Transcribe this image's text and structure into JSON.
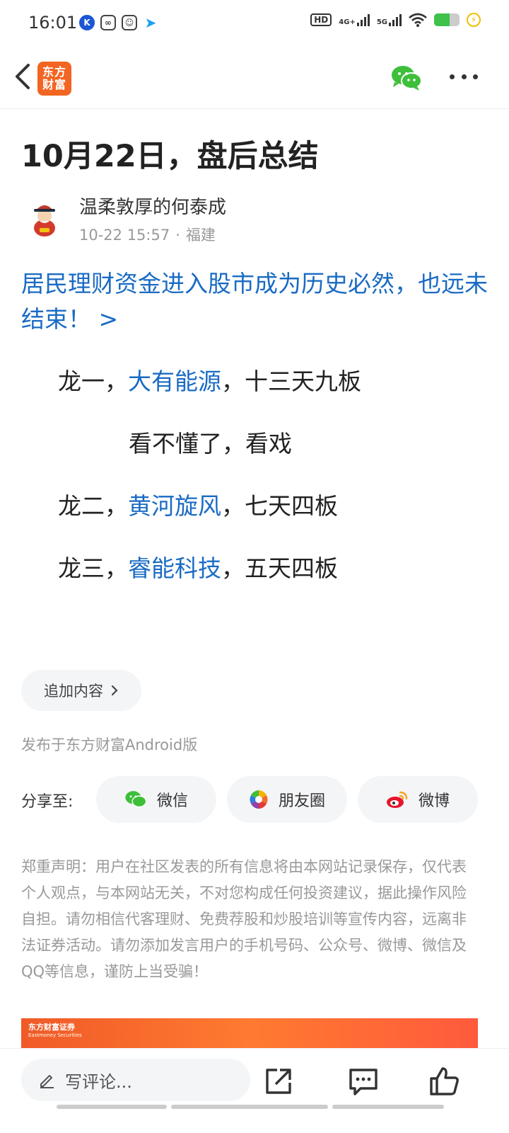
{
  "status_bar": {
    "time": "16:01",
    "network_hd": "HD",
    "network_4g": "4G+",
    "network_5g": "5G",
    "battery_level": 0.6
  },
  "header": {
    "logo_line1": "东方",
    "logo_line2": "财富",
    "icons": [
      "back-arrow-icon",
      "wechat-icon",
      "more-icon"
    ]
  },
  "article": {
    "title": "10月22日，盘后总结",
    "author": "温柔敦厚的何泰成",
    "time": "10-22 15:57",
    "location": "福建",
    "link_text": "居民理财资金进入股市成为历史必然，也远未结束！ >",
    "lines": [
      {
        "prefix": "龙一，",
        "stock": "大有能源",
        "suffix": "，十三天九板"
      },
      {
        "text": "看不懂了，看戏"
      },
      {
        "prefix": "龙二，",
        "stock": "黄河旋风",
        "suffix": "，七天四板"
      },
      {
        "prefix": "龙三，",
        "stock": "睿能科技",
        "suffix": "，五天四板"
      }
    ]
  },
  "append_label": "追加内容",
  "published": "发布于东方财富Android版",
  "share": {
    "label": "分享至:",
    "wechat": "微信",
    "moments": "朋友圈",
    "weibo": "微博"
  },
  "disclaimer": "郑重声明：用户在社区发表的所有信息将由本网站记录保存，仅代表个人观点，与本网站无关，不对您构成任何投资建议，据此操作风险自担。请勿相信代客理财、免费荐股和炒股培训等宣传内容，远离非法证券活动。请勿添加发言用户的手机号码、公众号、微博、微信及QQ等信息，谨防上当受骗！",
  "banner": {
    "brand": "东方财富证券",
    "sub": "Eastmoney Securities"
  },
  "bottom": {
    "comment_placeholder": "写评论..."
  },
  "colors": {
    "link": "#1a6bc4",
    "brand": "#f26522"
  }
}
